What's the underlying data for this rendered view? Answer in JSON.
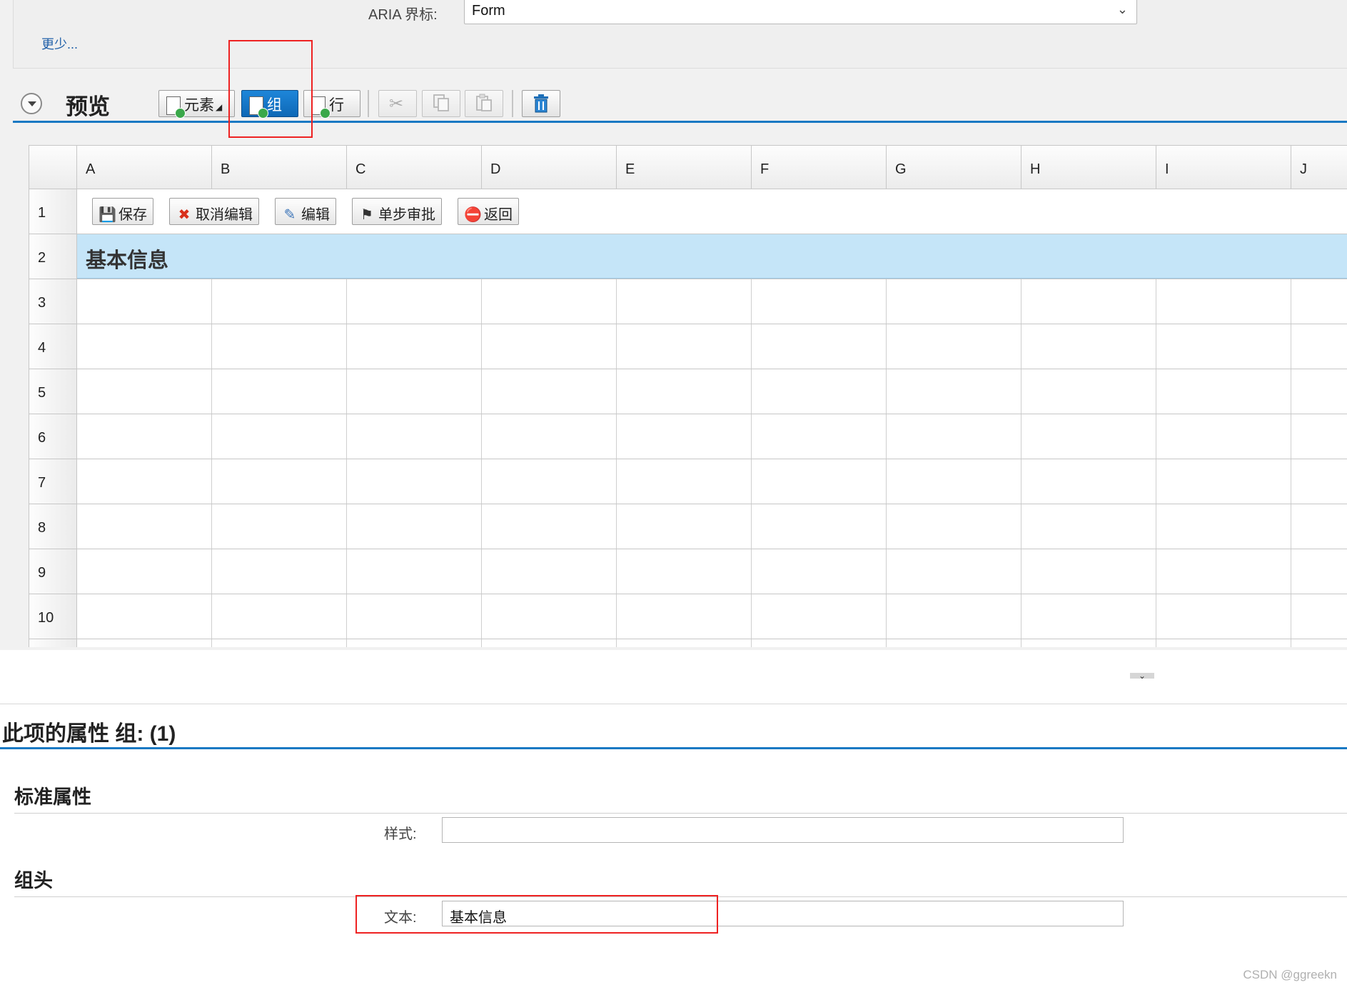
{
  "top": {
    "aria_label": "ARIA 界标:",
    "aria_value": "Form",
    "less_link": "更少..."
  },
  "preview": {
    "title": "预览",
    "toolbar": {
      "element": "元素",
      "group": "组",
      "row": "行",
      "cut_icon": "scissors-icon",
      "copy_icon": "copy-icon",
      "paste_icon": "paste-icon",
      "delete_icon": "trash-icon"
    }
  },
  "grid": {
    "columns": [
      "A",
      "B",
      "C",
      "D",
      "E",
      "F",
      "G",
      "H",
      "I",
      "J"
    ],
    "rows": [
      "1",
      "2",
      "3",
      "4",
      "5",
      "6",
      "7",
      "8",
      "9",
      "10"
    ],
    "row1_buttons": [
      {
        "label": "保存",
        "icon": "save-icon"
      },
      {
        "label": "取消编辑",
        "icon": "cancel-icon"
      },
      {
        "label": "编辑",
        "icon": "pencil-icon"
      },
      {
        "label": "单步审批",
        "icon": "flag-icon"
      },
      {
        "label": "返回",
        "icon": "return-icon"
      }
    ],
    "group_text": "基本信息"
  },
  "properties": {
    "title": "此项的属性 组: (1)",
    "standard_section": "标准属性",
    "style_label": "样式:",
    "style_value": "",
    "group_header_section": "组头",
    "text_label": "文本:",
    "text_value": "基本信息"
  },
  "watermark": "CSDN @ggreekn",
  "colors": {
    "accent_blue": "#1a79c3",
    "group_row_bg": "#c5e5f8",
    "highlight_red": "#e22222"
  }
}
